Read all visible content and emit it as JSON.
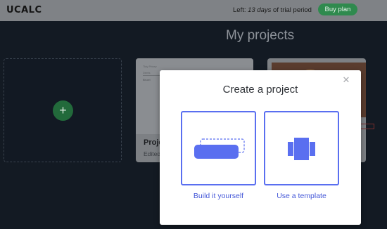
{
  "header": {
    "logo": "UCALC",
    "trial_prefix": "Left: ",
    "trial_days": "13 days",
    "trial_suffix": " of trial period",
    "buy_label": "Buy plan"
  },
  "page": {
    "title": "My projects",
    "projects": [
      {
        "name": "Proje",
        "edited": "Edited",
        "thumb_texts": [
          "Tidy Pricey",
          "Dents",
          "Brunt"
        ]
      }
    ]
  },
  "modal": {
    "title": "Create a project",
    "options": [
      {
        "label": "Build it yourself",
        "icon": "build-icon"
      },
      {
        "label": "Use a template",
        "icon": "template-icon"
      }
    ],
    "close_icon": "close-icon"
  },
  "colors": {
    "accent": "#5a6ff0",
    "accent_text": "#4558d8",
    "buy_button": "#2f8a4e",
    "background": "#131a23",
    "add_button": "#226a3b"
  }
}
